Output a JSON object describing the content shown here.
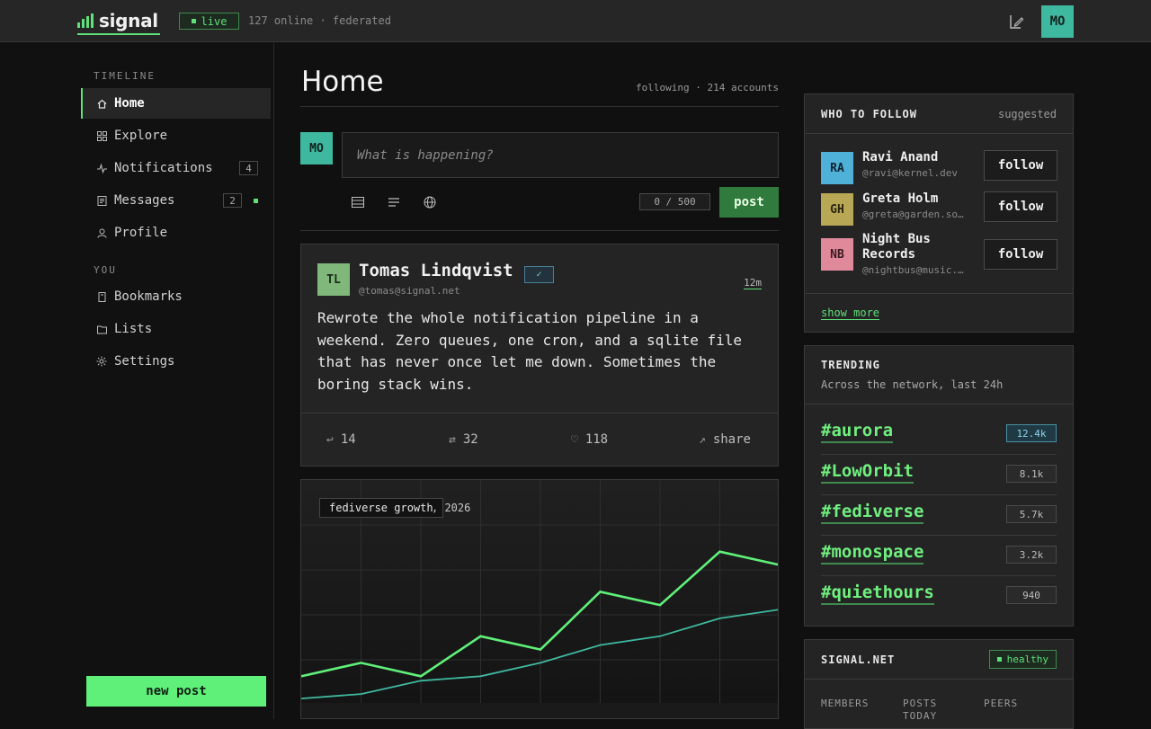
{
  "app": {
    "name": "signal",
    "live_label": "live",
    "online_text": "127 online · federated",
    "user_initials": "MO"
  },
  "sidebar": {
    "timeline_label": "TIMELINE",
    "you_label": "YOU",
    "items": [
      {
        "label": "Home",
        "icon": "home-icon"
      },
      {
        "label": "Explore",
        "icon": "grid-icon"
      },
      {
        "label": "Notifications",
        "icon": "pulse-icon",
        "count": "4"
      },
      {
        "label": "Messages",
        "icon": "message-icon",
        "count": "2"
      },
      {
        "label": "Profile",
        "icon": "user-icon"
      }
    ],
    "you_items": [
      {
        "label": "Bookmarks",
        "icon": "bookmark-icon"
      },
      {
        "label": "Lists",
        "icon": "folder-icon"
      },
      {
        "label": "Settings",
        "icon": "gear-icon"
      }
    ],
    "new_post_label": "new post"
  },
  "main": {
    "title": "Home",
    "following": "following · 214 accounts",
    "compose": {
      "avatar": "MO",
      "placeholder": "What is happening?",
      "char_count": "0 / 500",
      "post_label": "post"
    },
    "post": {
      "avatar": "TL",
      "author": "Tomas Lindqvist",
      "verified": "✓",
      "handle": "@tomas@signal.net",
      "time": "12m",
      "body": "Rewrote the whole notification pipeline in a weekend. Zero queues, one cron, and a sqlite file that has never once let me down. Sometimes the boring stack wins.",
      "replies": "14",
      "boosts": "32",
      "likes": "118",
      "share": "share"
    },
    "chart_tag": "fediverse growth",
    "chart_tag_year": ", 2026"
  },
  "chart_data": {
    "type": "line",
    "title": "fediverse growth, 2026",
    "x": [
      0,
      1,
      2,
      3,
      4,
      5,
      6,
      7,
      8
    ],
    "series": [
      {
        "values": [
          3.0,
          4.5,
          3.0,
          7.5,
          6.0,
          12.5,
          11.0,
          17.0,
          15.5
        ],
        "color": "#5ff07a"
      },
      {
        "values": [
          0.5,
          1.0,
          2.5,
          3.0,
          4.5,
          6.5,
          7.5,
          9.5,
          10.5
        ],
        "color": "#3fb8a0"
      }
    ],
    "ylim": [
      0,
      20
    ],
    "grid": true
  },
  "who_to_follow": {
    "title": "WHO TO FOLLOW",
    "meta": "suggested",
    "users": [
      {
        "initials": "RA",
        "name": "Ravi Anand",
        "handle": "@ravi@kernel.dev",
        "color": "#4fb0d8"
      },
      {
        "initials": "GH",
        "name": "Greta Holm",
        "handle": "@greta@garden.so…",
        "color": "#b8a855"
      },
      {
        "initials": "NB",
        "name": "Night Bus Records",
        "handle": "@nightbus@music.…",
        "color": "#e0899a"
      }
    ],
    "follow_label": "follow",
    "show_more": "show more"
  },
  "trending": {
    "title": "TRENDING",
    "subtitle": "Across the network, last 24h",
    "items": [
      {
        "tag": "#aurora",
        "count": "12.4k"
      },
      {
        "tag": "#LowOrbit",
        "count": "8.1k"
      },
      {
        "tag": "#fediverse",
        "count": "5.7k"
      },
      {
        "tag": "#monospace",
        "count": "3.2k"
      },
      {
        "tag": "#quiethours",
        "count": "940"
      }
    ]
  },
  "instance": {
    "title": "SIGNAL.NET",
    "status": "healthy",
    "stats": [
      "MEMBERS",
      "POSTS TODAY",
      "PEERS"
    ]
  },
  "colors": {
    "accent": "#5fe07a",
    "teal": "#3fb8a0"
  }
}
